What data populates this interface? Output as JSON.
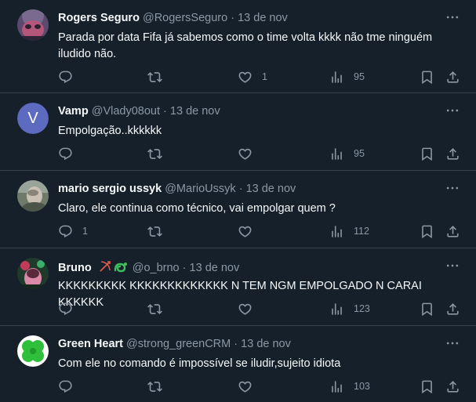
{
  "tweets": [
    {
      "name": "Rogers Seguro",
      "handle": "@RogersSeguro",
      "dot": "·",
      "date": "13 de nov",
      "text": "Parada por data Fifa já sabemos como o time volta kkkk não tme ninguém iludido não.",
      "replies": "",
      "retweets": "",
      "likes": "1",
      "views": "95",
      "avatar": "photo"
    },
    {
      "name": "Vamp",
      "handle": "@Vlady08out",
      "dot": "·",
      "date": "13 de nov",
      "text": "Empolgação..kkkkkk",
      "replies": "",
      "retweets": "",
      "likes": "",
      "views": "95",
      "avatar_letter": "V",
      "avatar_color": "#5c6bc0"
    },
    {
      "name": "mario sergio ussyk",
      "handle": "@MarioUssyk",
      "dot": "·",
      "date": "13 de nov",
      "text": "Claro, ele continua como técnico, vai empolgar quem ?",
      "replies": "1",
      "retweets": "",
      "likes": "",
      "views": "112",
      "avatar": "photo"
    },
    {
      "name": "Bruno",
      "handle": "@o_brno",
      "dot": "·",
      "date": "13 de nov",
      "text": "KKKKKKKKK KKKKKKKKKKKKK N TEM NGM EMPOLGADO N CARAI KKKKKK",
      "replies": "",
      "retweets": "",
      "likes": "",
      "views": "123",
      "avatar": "photo",
      "badges": [
        "bow-arrow-emoji",
        "snake-emoji"
      ]
    },
    {
      "name": "Green Heart",
      "handle": "@strong_greenCRM",
      "dot": "·",
      "date": "13 de nov",
      "text": "Com ele no comando é impossível se iludir,sujeito idiota",
      "replies": "",
      "retweets": "",
      "likes": "",
      "views": "103",
      "avatar": "clover"
    }
  ],
  "colors": {
    "background": "#15202b",
    "text": "#f7f9f9",
    "secondary": "#8b98a5",
    "divider": "#38444d"
  }
}
